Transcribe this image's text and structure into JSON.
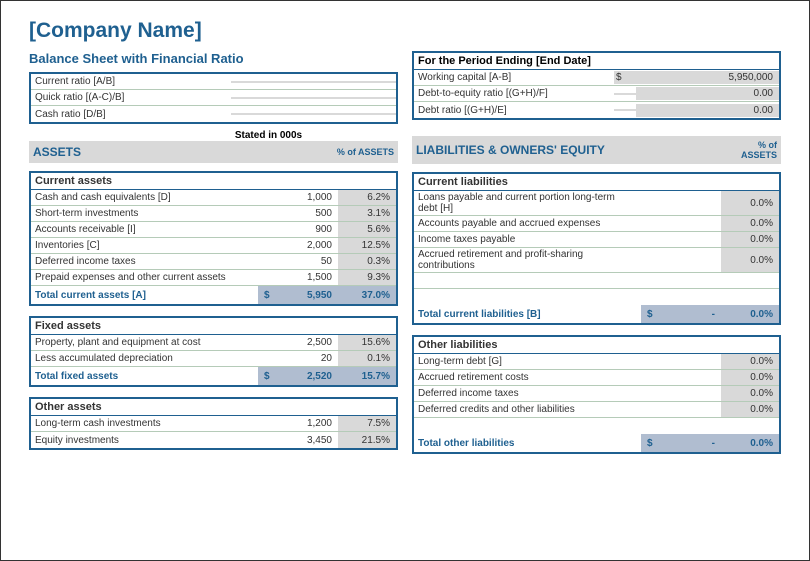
{
  "companyName": "[Company Name]",
  "subtitle": "Balance Sheet with Financial Ratio",
  "periodTitle": "For the Period Ending [End Date]",
  "stated": "Stated in 000s",
  "leftRatios": [
    {
      "label": "Current ratio [A/B]",
      "value": ""
    },
    {
      "label": "Quick ratio [(A-C)/B]",
      "value": ""
    },
    {
      "label": "Cash ratio [D/B]",
      "value": ""
    }
  ],
  "rightRatios": [
    {
      "label": "Working capital [A-B]",
      "currency": "$",
      "value": "5,950,000"
    },
    {
      "label": "Debt-to-equity ratio [(G+H)/F]",
      "currency": "",
      "value": "0.00"
    },
    {
      "label": "Debt ratio [(G+H)/E]",
      "currency": "",
      "value": "0.00"
    }
  ],
  "assetsHeader": "ASSETS",
  "liabHeader": "LIABILITIES & OWNERS' EQUITY",
  "pctHeader": "% of\nASSETS",
  "pctHeaderFlat": "% of ASSETS",
  "assets": {
    "current": {
      "header": "Current assets",
      "rows": [
        {
          "label": "Cash and cash equivalents [D]",
          "value": "1,000",
          "pct": "6.2%"
        },
        {
          "label": "Short-term investments",
          "value": "500",
          "pct": "3.1%"
        },
        {
          "label": "Accounts receivable [I]",
          "value": "900",
          "pct": "5.6%"
        },
        {
          "label": "Inventories [C]",
          "value": "2,000",
          "pct": "12.5%"
        },
        {
          "label": "Deferred income taxes",
          "value": "50",
          "pct": "0.3%"
        },
        {
          "label": "Prepaid expenses and other current assets",
          "value": "1,500",
          "pct": "9.3%"
        }
      ],
      "totalLabel": "Total current assets [A]",
      "totalCurrency": "$",
      "totalValue": "5,950",
      "totalPct": "37.0%"
    },
    "fixed": {
      "header": "Fixed assets",
      "rows": [
        {
          "label": "Property, plant and equipment at cost",
          "value": "2,500",
          "pct": "15.6%"
        },
        {
          "label": "Less accumulated depreciation",
          "value": "20",
          "pct": "0.1%"
        }
      ],
      "totalLabel": "Total fixed assets",
      "totalCurrency": "$",
      "totalValue": "2,520",
      "totalPct": "15.7%"
    },
    "other": {
      "header": "Other assets",
      "rows": [
        {
          "label": "Long-term cash investments",
          "value": "1,200",
          "pct": "7.5%"
        },
        {
          "label": "Equity investments",
          "value": "3,450",
          "pct": "21.5%"
        }
      ]
    }
  },
  "liabilities": {
    "current": {
      "header": "Current liabilities",
      "rows": [
        {
          "label": "Loans payable and current portion long-term debt [H]",
          "value": "",
          "pct": "0.0%"
        },
        {
          "label": "Accounts payable and accrued expenses",
          "value": "",
          "pct": "0.0%"
        },
        {
          "label": "Income taxes payable",
          "value": "",
          "pct": "0.0%"
        },
        {
          "label": "Accrued retirement and profit-sharing contributions",
          "value": "",
          "pct": "0.0%"
        }
      ],
      "totalLabel": "Total current liabilities [B]",
      "totalCurrency": "$",
      "totalValue": "-",
      "totalPct": "0.0%"
    },
    "other": {
      "header": "Other liabilities",
      "rows": [
        {
          "label": "Long-term debt [G]",
          "value": "",
          "pct": "0.0%"
        },
        {
          "label": "Accrued retirement costs",
          "value": "",
          "pct": "0.0%"
        },
        {
          "label": "Deferred income taxes",
          "value": "",
          "pct": "0.0%"
        },
        {
          "label": "Deferred credits and other liabilities",
          "value": "",
          "pct": "0.0%"
        }
      ],
      "totalLabel": "Total other liabilities",
      "totalCurrency": "$",
      "totalValue": "-",
      "totalPct": "0.0%"
    }
  }
}
